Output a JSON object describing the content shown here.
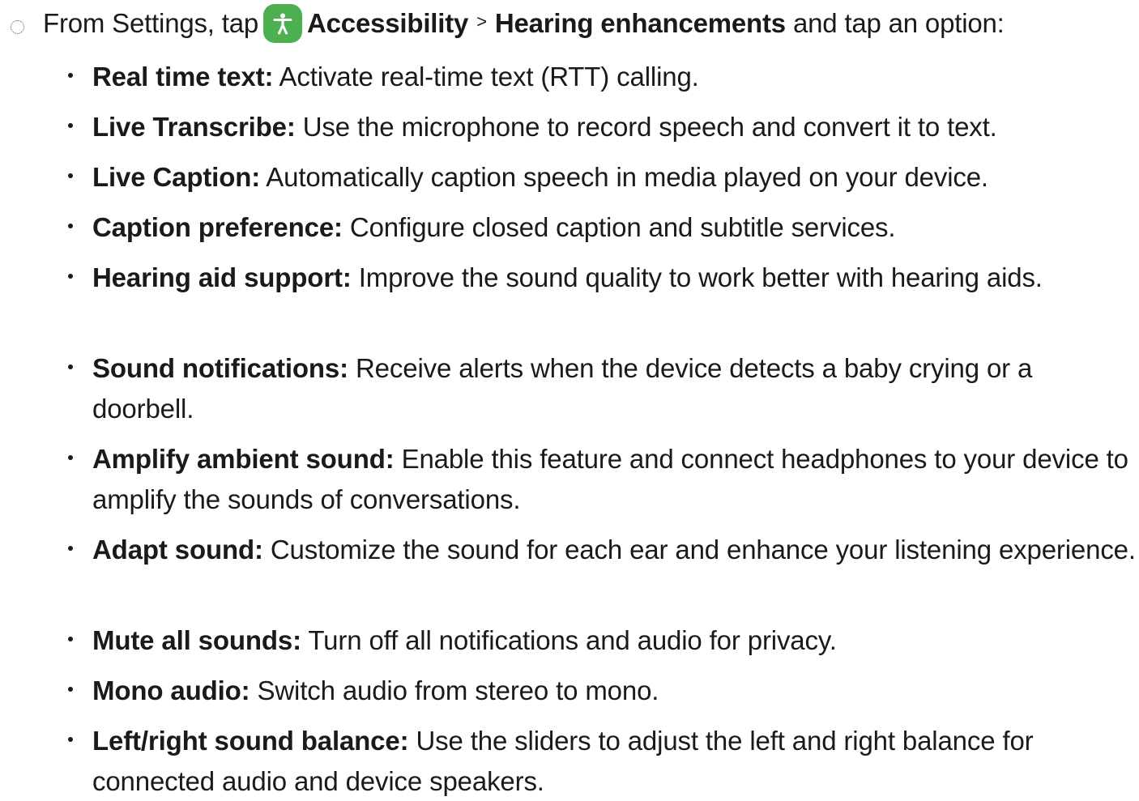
{
  "step": {
    "intro": "From Settings, tap",
    "app_icon_name": "accessibility-icon",
    "app_icon_color": "#4caf50",
    "path_first": "Accessibility",
    "separator": ">",
    "path_second": "Hearing enhancements",
    "outro": "and tap an option:"
  },
  "options": [
    {
      "term": "Real time text:",
      "description": "Activate real-time text (RTT) calling."
    },
    {
      "term": "Live Transcribe:",
      "description": "Use the microphone to record speech and convert it to text."
    },
    {
      "term": "Live Caption:",
      "description": "Automatically caption speech in media played on your device."
    },
    {
      "term": "Caption preference:",
      "description": "Configure closed caption and subtitle services."
    },
    {
      "term": "Hearing aid support:",
      "description": "Improve the sound quality to work better with hearing aids."
    },
    {
      "term": "Sound notifications:",
      "description": "Receive alerts when the device detects a baby crying or a doorbell."
    },
    {
      "term": "Amplify ambient sound:",
      "description": "Enable this feature and connect headphones to your device to amplify the sounds of conversations."
    },
    {
      "term": "Adapt sound:",
      "description": "Customize the sound for each ear and enhance your listening experience."
    },
    {
      "term": "Mute all sounds:",
      "description": "Turn off all notifications and audio for privacy."
    },
    {
      "term": "Mono audio:",
      "description": "Switch audio from stereo to mono."
    },
    {
      "term": "Left/right sound balance:",
      "description": "Use the sliders to adjust the left and right balance for connected audio and device speakers."
    }
  ]
}
